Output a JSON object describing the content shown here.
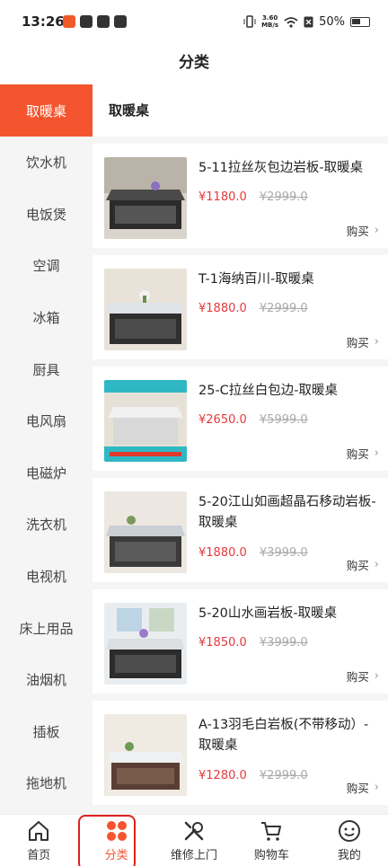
{
  "status_bar": {
    "time": "13:26",
    "net_speed_top": "3.60",
    "net_speed_bottom": "MB/s",
    "battery": "50%"
  },
  "header": {
    "title": "分类"
  },
  "sidebar": {
    "items": [
      {
        "label": "取暖桌",
        "active": true
      },
      {
        "label": "饮水机"
      },
      {
        "label": "电饭煲"
      },
      {
        "label": "空调"
      },
      {
        "label": "冰箱"
      },
      {
        "label": "厨具"
      },
      {
        "label": "电风扇"
      },
      {
        "label": "电磁炉"
      },
      {
        "label": "洗衣机"
      },
      {
        "label": "电视机"
      },
      {
        "label": "床上用品"
      },
      {
        "label": "油烟机"
      },
      {
        "label": "插板"
      },
      {
        "label": "拖地机"
      }
    ]
  },
  "main": {
    "section_title": "取暖桌",
    "products": [
      {
        "name": "5-11拉丝灰包边岩板-取暖桌",
        "price": "¥1180.0",
        "orig_price": "¥2999.0",
        "buy": "购买"
      },
      {
        "name": "T-1海纳百川-取暖桌",
        "price": "¥1880.0",
        "orig_price": "¥2999.0",
        "buy": "购买"
      },
      {
        "name": "25-C拉丝白包边-取暖桌",
        "price": "¥2650.0",
        "orig_price": "¥5999.0",
        "buy": "购买"
      },
      {
        "name": "5-20江山如画超晶石移动岩板-取暖桌",
        "price": "¥1880.0",
        "orig_price": "¥3999.0",
        "buy": "购买"
      },
      {
        "name": "5-20山水画岩板-取暖桌",
        "price": "¥1850.0",
        "orig_price": "¥3999.0",
        "buy": "购买"
      },
      {
        "name": "A-13羽毛白岩板(不带移动）-取暖桌",
        "price": "¥1280.0",
        "orig_price": "¥2999.0",
        "buy": "购买"
      }
    ]
  },
  "bottom_nav": {
    "items": [
      {
        "label": "首页",
        "icon": "home-icon"
      },
      {
        "label": "分类",
        "icon": "category-icon",
        "active": true
      },
      {
        "label": "维修上门",
        "icon": "repair-tools-icon"
      },
      {
        "label": "购物车",
        "icon": "cart-icon"
      },
      {
        "label": "我的",
        "icon": "profile-icon"
      }
    ]
  },
  "colors": {
    "accent": "#f4552e",
    "price": "#e4393c"
  }
}
